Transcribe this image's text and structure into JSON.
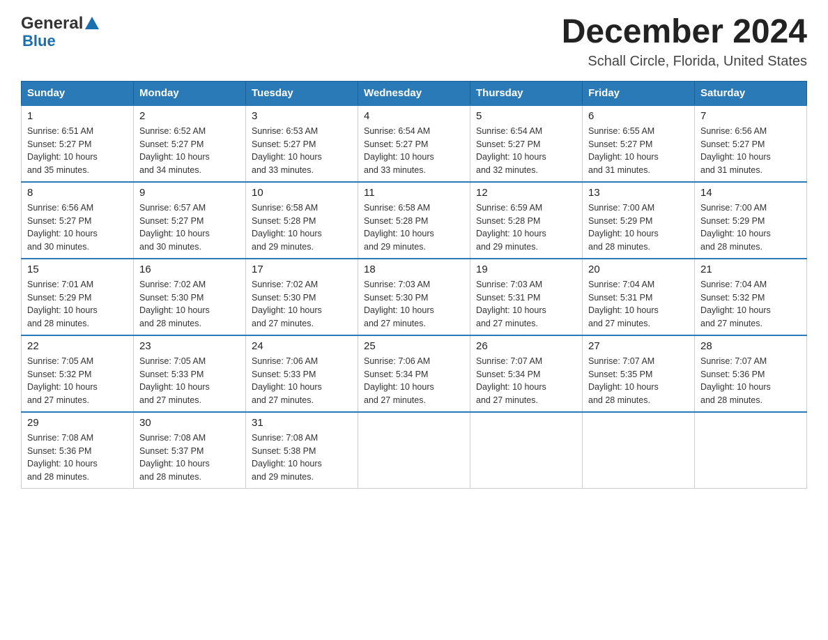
{
  "header": {
    "logo_general": "General",
    "logo_blue": "Blue",
    "month_title": "December 2024",
    "location": "Schall Circle, Florida, United States"
  },
  "days_of_week": [
    "Sunday",
    "Monday",
    "Tuesday",
    "Wednesday",
    "Thursday",
    "Friday",
    "Saturday"
  ],
  "weeks": [
    [
      {
        "day": "1",
        "sunrise": "6:51 AM",
        "sunset": "5:27 PM",
        "daylight": "10 hours and 35 minutes."
      },
      {
        "day": "2",
        "sunrise": "6:52 AM",
        "sunset": "5:27 PM",
        "daylight": "10 hours and 34 minutes."
      },
      {
        "day": "3",
        "sunrise": "6:53 AM",
        "sunset": "5:27 PM",
        "daylight": "10 hours and 33 minutes."
      },
      {
        "day": "4",
        "sunrise": "6:54 AM",
        "sunset": "5:27 PM",
        "daylight": "10 hours and 33 minutes."
      },
      {
        "day": "5",
        "sunrise": "6:54 AM",
        "sunset": "5:27 PM",
        "daylight": "10 hours and 32 minutes."
      },
      {
        "day": "6",
        "sunrise": "6:55 AM",
        "sunset": "5:27 PM",
        "daylight": "10 hours and 31 minutes."
      },
      {
        "day": "7",
        "sunrise": "6:56 AM",
        "sunset": "5:27 PM",
        "daylight": "10 hours and 31 minutes."
      }
    ],
    [
      {
        "day": "8",
        "sunrise": "6:56 AM",
        "sunset": "5:27 PM",
        "daylight": "10 hours and 30 minutes."
      },
      {
        "day": "9",
        "sunrise": "6:57 AM",
        "sunset": "5:27 PM",
        "daylight": "10 hours and 30 minutes."
      },
      {
        "day": "10",
        "sunrise": "6:58 AM",
        "sunset": "5:28 PM",
        "daylight": "10 hours and 29 minutes."
      },
      {
        "day": "11",
        "sunrise": "6:58 AM",
        "sunset": "5:28 PM",
        "daylight": "10 hours and 29 minutes."
      },
      {
        "day": "12",
        "sunrise": "6:59 AM",
        "sunset": "5:28 PM",
        "daylight": "10 hours and 29 minutes."
      },
      {
        "day": "13",
        "sunrise": "7:00 AM",
        "sunset": "5:29 PM",
        "daylight": "10 hours and 28 minutes."
      },
      {
        "day": "14",
        "sunrise": "7:00 AM",
        "sunset": "5:29 PM",
        "daylight": "10 hours and 28 minutes."
      }
    ],
    [
      {
        "day": "15",
        "sunrise": "7:01 AM",
        "sunset": "5:29 PM",
        "daylight": "10 hours and 28 minutes."
      },
      {
        "day": "16",
        "sunrise": "7:02 AM",
        "sunset": "5:30 PM",
        "daylight": "10 hours and 28 minutes."
      },
      {
        "day": "17",
        "sunrise": "7:02 AM",
        "sunset": "5:30 PM",
        "daylight": "10 hours and 27 minutes."
      },
      {
        "day": "18",
        "sunrise": "7:03 AM",
        "sunset": "5:30 PM",
        "daylight": "10 hours and 27 minutes."
      },
      {
        "day": "19",
        "sunrise": "7:03 AM",
        "sunset": "5:31 PM",
        "daylight": "10 hours and 27 minutes."
      },
      {
        "day": "20",
        "sunrise": "7:04 AM",
        "sunset": "5:31 PM",
        "daylight": "10 hours and 27 minutes."
      },
      {
        "day": "21",
        "sunrise": "7:04 AM",
        "sunset": "5:32 PM",
        "daylight": "10 hours and 27 minutes."
      }
    ],
    [
      {
        "day": "22",
        "sunrise": "7:05 AM",
        "sunset": "5:32 PM",
        "daylight": "10 hours and 27 minutes."
      },
      {
        "day": "23",
        "sunrise": "7:05 AM",
        "sunset": "5:33 PM",
        "daylight": "10 hours and 27 minutes."
      },
      {
        "day": "24",
        "sunrise": "7:06 AM",
        "sunset": "5:33 PM",
        "daylight": "10 hours and 27 minutes."
      },
      {
        "day": "25",
        "sunrise": "7:06 AM",
        "sunset": "5:34 PM",
        "daylight": "10 hours and 27 minutes."
      },
      {
        "day": "26",
        "sunrise": "7:07 AM",
        "sunset": "5:34 PM",
        "daylight": "10 hours and 27 minutes."
      },
      {
        "day": "27",
        "sunrise": "7:07 AM",
        "sunset": "5:35 PM",
        "daylight": "10 hours and 28 minutes."
      },
      {
        "day": "28",
        "sunrise": "7:07 AM",
        "sunset": "5:36 PM",
        "daylight": "10 hours and 28 minutes."
      }
    ],
    [
      {
        "day": "29",
        "sunrise": "7:08 AM",
        "sunset": "5:36 PM",
        "daylight": "10 hours and 28 minutes."
      },
      {
        "day": "30",
        "sunrise": "7:08 AM",
        "sunset": "5:37 PM",
        "daylight": "10 hours and 28 minutes."
      },
      {
        "day": "31",
        "sunrise": "7:08 AM",
        "sunset": "5:38 PM",
        "daylight": "10 hours and 29 minutes."
      },
      null,
      null,
      null,
      null
    ]
  ],
  "labels": {
    "sunrise": "Sunrise:",
    "sunset": "Sunset:",
    "daylight": "Daylight:"
  }
}
